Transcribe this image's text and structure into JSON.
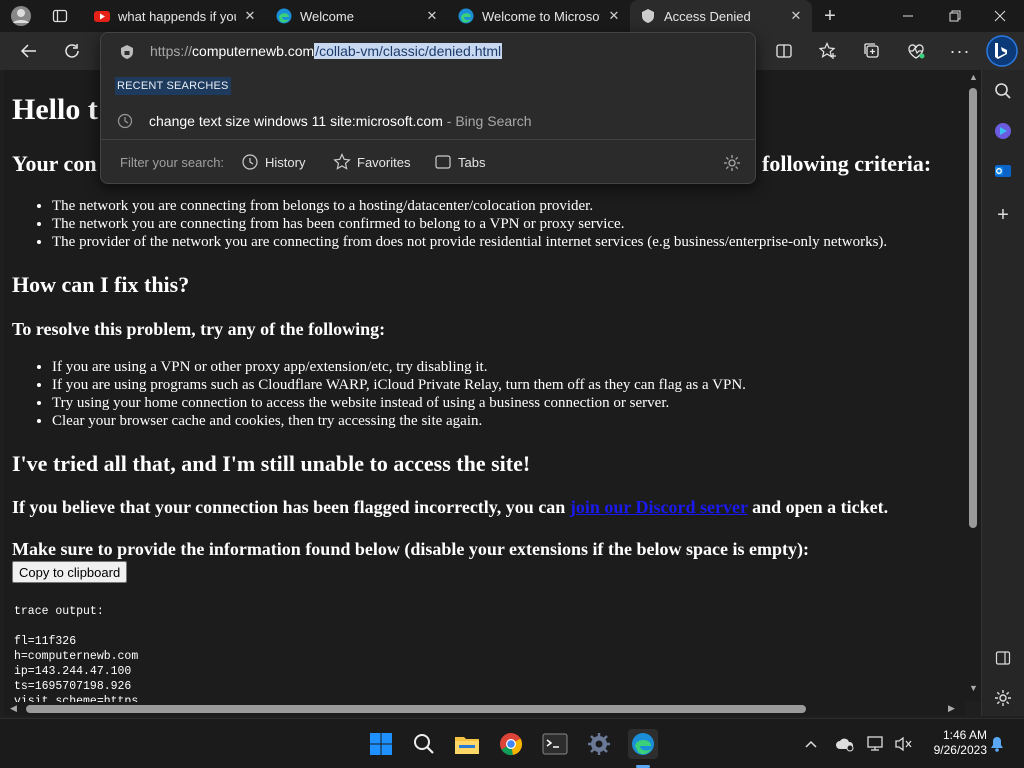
{
  "browser": {
    "tabs": [
      {
        "title": "what happends if you",
        "icon": "youtube-icon"
      },
      {
        "title": "Welcome",
        "icon": "edge-icon"
      },
      {
        "title": "Welcome to Microsoft",
        "icon": "edge-icon"
      },
      {
        "title": "Access Denied",
        "icon": "cloudflare-icon",
        "active": true
      }
    ],
    "address": {
      "protocol": "https://",
      "host": "computernewb.com",
      "path": "/collab-vm/classic/denied.html"
    },
    "dropdown": {
      "section_label": "RECENT SEARCHES",
      "recent_query": "change text size windows 11 site:microsoft.com",
      "recent_source": " - Bing Search",
      "filter_label": "Filter your search:",
      "filters": [
        "History",
        "Favorites",
        "Tabs"
      ]
    }
  },
  "page": {
    "heading": "Hello t",
    "subheading_left": "Your con",
    "subheading_right": "following criteria:",
    "criteria": [
      "The network you are connecting from belongs to a hosting/datacenter/colocation provider.",
      "The network you are connecting from has been confirmed to belong to a VPN or proxy service.",
      "The provider of the network you are connecting from does not provide residential internet services (e.g business/enterprise-only networks)."
    ],
    "fix_heading": "How can I fix this?",
    "resolve_heading": "To resolve this problem, try any of the following:",
    "fixes": [
      "If you are using a VPN or other proxy app/extension/etc, try disabling it.",
      "If you are using programs such as Cloudflare WARP, iCloud Private Relay, turn them off as they can flag as a VPN.",
      "Try using your home connection to access the website instead of using a business connection or server.",
      "Clear your browser cache and cookies, then try accessing the site again."
    ],
    "tried_heading": "I've tried all that, and I'm still unable to access the site!",
    "flagged_prefix": "If you believe that your connection has been flagged incorrectly, you can ",
    "discord_link": "join our Discord server",
    "flagged_suffix": " and open a ticket.",
    "provide_info": "Make sure to provide the information found below (disable your extensions if the below space is empty):",
    "copy_button": "Copy to clipboard",
    "trace_label": "trace output:",
    "trace_lines": [
      "fl=11f326",
      "h=computernewb.com",
      "ip=143.244.47.100",
      "ts=1695707198.926",
      "visit_scheme=https"
    ]
  },
  "taskbar": {
    "time": "1:46 AM",
    "date": "9/26/2023"
  }
}
